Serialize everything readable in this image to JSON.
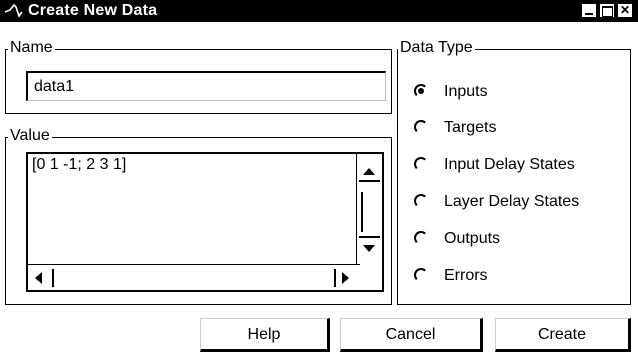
{
  "window": {
    "title": "Create New Data",
    "icon": "matlab-logo-icon",
    "controls": {
      "minimize": "minimize-icon",
      "maximize": "maximize-icon",
      "close": "close-icon",
      "close_glyph": "✕"
    }
  },
  "name_group": {
    "legend": "Name",
    "value": "data1"
  },
  "value_group": {
    "legend": "Value",
    "value": "[0 1 -1; 2 3 1]"
  },
  "data_type_group": {
    "legend": "Data Type",
    "options": [
      {
        "label": "Inputs",
        "selected": true
      },
      {
        "label": "Targets",
        "selected": false
      },
      {
        "label": "Input Delay States",
        "selected": false
      },
      {
        "label": "Layer Delay States",
        "selected": false
      },
      {
        "label": "Outputs",
        "selected": false
      },
      {
        "label": "Errors",
        "selected": false
      }
    ]
  },
  "buttons": {
    "help": "Help",
    "cancel": "Cancel",
    "create": "Create"
  }
}
